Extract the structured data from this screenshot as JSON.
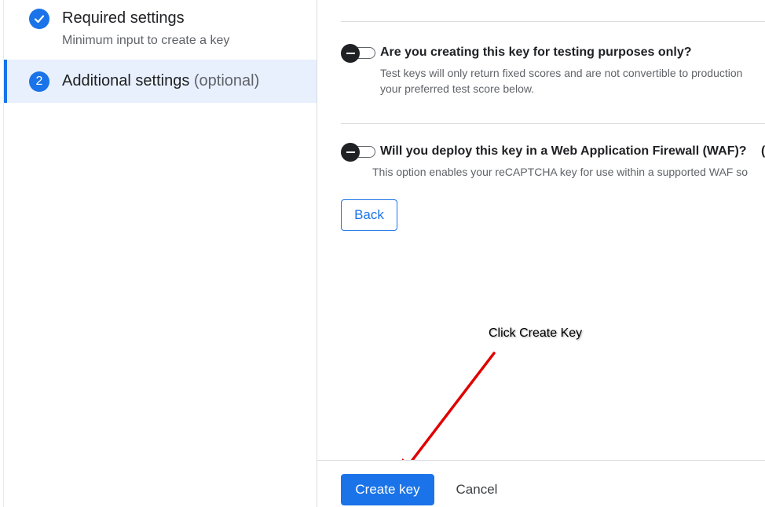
{
  "steps": [
    {
      "number": "",
      "title": "Required settings",
      "subtitle": "Minimum input to create a key",
      "state": "completed",
      "icon": "check-icon"
    },
    {
      "number": "2",
      "title": "Additional settings",
      "optional_label": "(optional)",
      "state": "active"
    }
  ],
  "options": {
    "testing": {
      "title": "Are you creating this key for testing purposes only?",
      "description": "Test keys will only return fixed scores and are not convertible to production your preferred test score below.",
      "enabled": false
    },
    "waf": {
      "title": "Will you deploy this key in a Web Application Firewall (WAF)?",
      "help_glyph": "(",
      "description": "This option enables your reCAPTCHA key for use within a supported WAF so",
      "enabled": false
    }
  },
  "buttons": {
    "back": "Back",
    "create": "Create key",
    "cancel": "Cancel"
  },
  "annotation": {
    "text": "Click Create Key",
    "arrow_color": "#e00000"
  },
  "colors": {
    "accent": "#1a73e8",
    "active_step_bg": "#e8f0fe",
    "divider": "#dadce0"
  }
}
